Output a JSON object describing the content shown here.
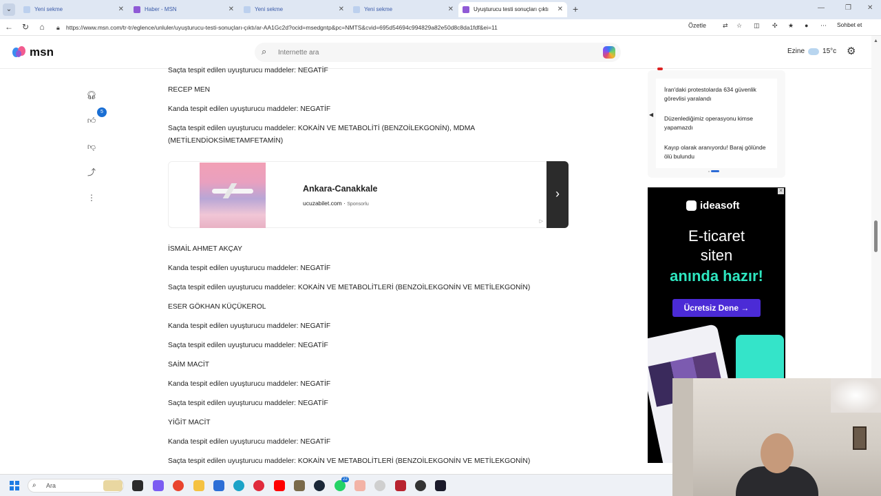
{
  "browser": {
    "tabs": [
      {
        "title": "Yeni sekme",
        "active": false
      },
      {
        "title": "Haber - MSN",
        "active": false
      },
      {
        "title": "Yeni sekme",
        "active": false
      },
      {
        "title": "Yeni sekme",
        "active": false
      },
      {
        "title": "Uyuşturucu testi sonuçları çıktı",
        "active": true
      }
    ],
    "url": "https://www.msn.com/tr-tr/eglence/unluler/uyuşturucu-testi-sonuçları-çıktı/ar-AA1Gc2d?ocid=msedgntp&pc=NMTS&cvid=695d54694c994829a82e50d8c8da1fdf&ei=11",
    "address_right": {
      "label": "Özetle"
    },
    "sohbet_label": "Sohbet et"
  },
  "msn": {
    "logo_text": "msn",
    "search_placeholder": "İnternette ara",
    "weather_label": "Ezine",
    "weather_temp": "15°c",
    "rail_badge": "5"
  },
  "article": {
    "lines": [
      "Saçta tespit edilen uyuşturucu maddeler: NEGATİF",
      "RECEP MEN",
      "Kanda tespit edilen uyuşturucu maddeler: NEGATİF",
      "Saçta tespit edilen uyuşturucu maddeler: KOKAİN VE METABOLİTİ (BENZOİLEKGONİN), MDMA (METİLENDİOKSİMETAMFETAMİN)",
      "İSMAİL AHMET AKÇAY",
      "Kanda tespit edilen uyuşturucu maddeler: NEGATİF",
      "Saçta tespit edilen uyuşturucu maddeler: KOKAİN VE METABOLİTLERİ (BENZOİLEKGONİN VE METİLEKGONİN)",
      "ESER GÖKHAN KÜÇÜKEROL",
      "Kanda tespit edilen uyuşturucu maddeler: NEGATİF",
      "Saçta tespit edilen uyuşturucu maddeler: NEGATİF",
      "SAİM MACİT",
      "Kanda tespit edilen uyuşturucu maddeler: NEGATİF",
      "Saçta tespit edilen uyuşturucu maddeler: NEGATİF",
      "YİĞİT MACİT",
      "Kanda tespit edilen uyuşturucu maddeler: NEGATİF",
      "Saçta tespit edilen uyuşturucu maddeler: KOKAİN VE METABOLİTLERİ (BENZOİLEKGONİN VE METİLEKGONİN)"
    ]
  },
  "ad": {
    "title": "Ankara-Canakkale",
    "source": "ucuzabilet.com",
    "sponsor": "Sponsorlu"
  },
  "news": {
    "items": [
      "İran'daki protestolarda 634 güvenlik görevlisi yaralandı",
      "Düzenlediğimiz operasyonu kimse yapamazdı",
      "Kayıp olarak aranıyordu! Baraj gölünde ölü bulundu"
    ]
  },
  "banner": {
    "brand": "ideasoft",
    "line1": "E-ticaret",
    "line2": "siten",
    "line3": "anında hazır!",
    "cta": "Ücretsiz Dene →"
  },
  "taskbar": {
    "search_placeholder": "Ara",
    "badge": "22"
  }
}
